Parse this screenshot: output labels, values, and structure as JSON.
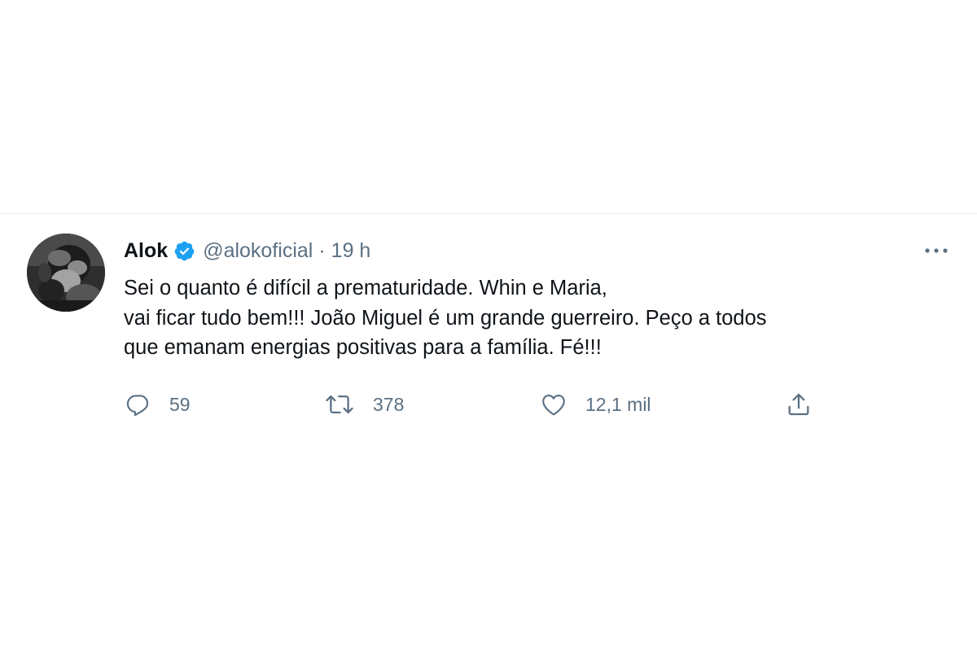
{
  "tweet": {
    "author": {
      "name": "Alok",
      "handle": "@alokoficial",
      "verified": true,
      "avatar_icon": "profile-photo"
    },
    "separator": "·",
    "time": "19 h",
    "text_lines": [
      "Sei o quanto é difícil a prematuridade. Whin e Maria,",
      "vai ficar tudo bem!!! João Miguel é um grande guerreiro. Peço a todos",
      "que emanam energias positivas para a família. Fé!!!"
    ],
    "actions": {
      "reply": {
        "icon": "reply-icon",
        "count": "59"
      },
      "retweet": {
        "icon": "retweet-icon",
        "count": "378"
      },
      "like": {
        "icon": "heart-icon",
        "count": "12,1 mil"
      },
      "share": {
        "icon": "share-icon"
      }
    },
    "more_icon": "more-horizontal-icon"
  },
  "colors": {
    "primary_text": "#0f1419",
    "secondary_text": "#5b7083",
    "verified_blue": "#1da1f2",
    "divider": "#e6ecf0",
    "background": "#ffffff"
  }
}
